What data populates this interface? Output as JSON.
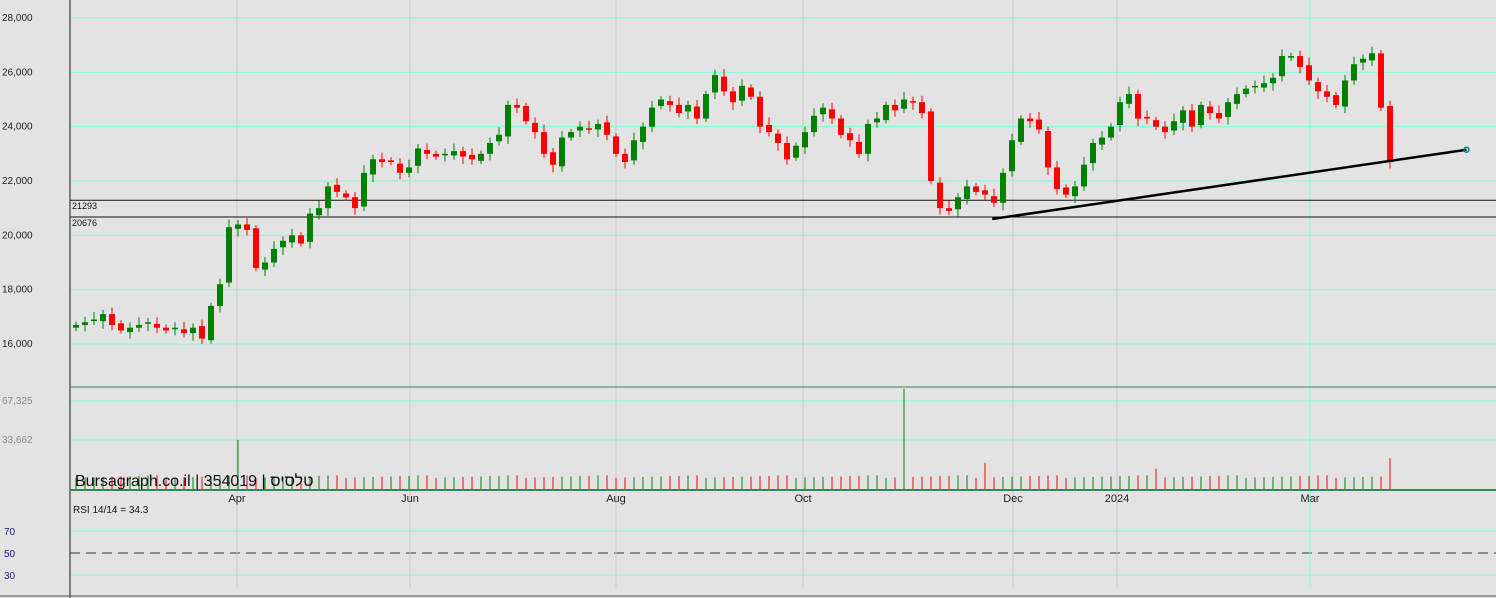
{
  "chart_data": {
    "type": "candlestick",
    "title": "Bursagraph.co.il | 354019 | טלסיס",
    "watermark": {
      "site": "Bursagraph.co.il",
      "code": "354019",
      "name": "טלסיס"
    },
    "price_axis": {
      "ticks": [
        "28,000",
        "26,000",
        "24,000",
        "22,000",
        "20,000",
        "18,000",
        "16,000"
      ],
      "values": [
        28000,
        26000,
        24000,
        22000,
        20000,
        18000,
        16000
      ],
      "ylim": [
        15400,
        28400
      ]
    },
    "x_labels": [
      "Apr",
      "Jun",
      "Aug",
      "Oct",
      "Dec",
      "2024",
      "Mar"
    ],
    "support_lines": [
      {
        "value": 21293,
        "label": "21293"
      },
      {
        "value": 20676,
        "label": "20676"
      }
    ],
    "trendline": {
      "from": {
        "index": 101.8,
        "price": 20600
      },
      "to": {
        "index": 154.5,
        "price": 23150
      }
    },
    "closes": [
      16700,
      16800,
      16900,
      17100,
      16700,
      16500,
      16600,
      16700,
      16800,
      16600,
      16500,
      16600,
      16400,
      16600,
      16200,
      17400,
      18200,
      20300,
      20400,
      20200,
      18800,
      19000,
      19500,
      19800,
      20000,
      19700,
      20800,
      21000,
      21800,
      21600,
      21400,
      21000,
      22300,
      22800,
      22700,
      22700,
      22300,
      22500,
      23200,
      23000,
      22900,
      23000,
      23100,
      22900,
      22800,
      23000,
      23400,
      23700,
      24800,
      24700,
      24200,
      23800,
      23000,
      22600,
      23600,
      23800,
      24000,
      23900,
      24100,
      23700,
      23000,
      22700,
      23500,
      24000,
      24700,
      25000,
      24800,
      24500,
      24800,
      24300,
      25200,
      25900,
      25300,
      24900,
      25500,
      25100,
      24000,
      23800,
      23400,
      22800,
      23300,
      23800,
      24400,
      24700,
      24300,
      23700,
      23500,
      23000,
      24100,
      24300,
      24800,
      24600,
      25000,
      24900,
      24500,
      22000,
      21000,
      20900,
      21400,
      21800,
      21600,
      21500,
      21200,
      22300,
      23500,
      24300,
      24200,
      23900,
      22500,
      21700,
      21500,
      21800,
      22600,
      23400,
      23600,
      24000,
      24900,
      25200,
      24300,
      24300,
      24000,
      23800,
      24200,
      24600,
      24000,
      24800,
      24500,
      24300,
      24900,
      25200,
      25400,
      25500,
      25600,
      25800,
      26600,
      26600,
      26200,
      25700,
      25300,
      25100,
      24800,
      25700,
      26300,
      26500,
      26700,
      24700,
      22700
    ],
    "volume_axis": {
      "ticks": [
        "67,325",
        "33,662"
      ],
      "values": [
        67325,
        33662
      ]
    },
    "volume_base": 2500,
    "volume_spikes": [
      {
        "index": 18,
        "value": 33662
      },
      {
        "index": 92,
        "value": 78000
      },
      {
        "index": 101,
        "value": 14000
      },
      {
        "index": 120,
        "value": 9000
      },
      {
        "index": 146,
        "value": 18000
      }
    ],
    "rsi": {
      "label": "RSI 14/14 = 34.3",
      "period": 14,
      "ma_period": 14,
      "ticks": [
        "70",
        "50",
        "30"
      ],
      "values": [
        70,
        50,
        30
      ],
      "mid_line": 50
    },
    "colors": {
      "up": "#008000",
      "down": "#ff0000",
      "grid": "#7fffd4",
      "rsi": "#000000",
      "rsi_ma": "#808000",
      "mid": "#ff0000"
    }
  }
}
